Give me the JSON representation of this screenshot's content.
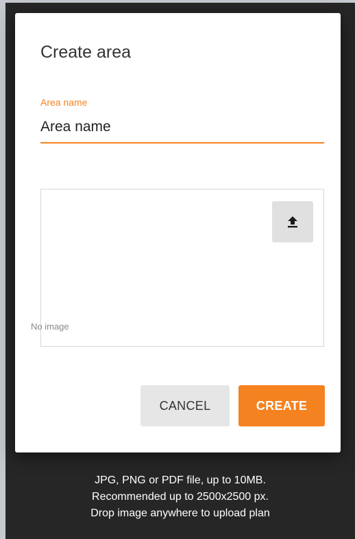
{
  "dialog": {
    "title": "Create area",
    "name_field": {
      "label": "Area name",
      "value": "Area name"
    },
    "image": {
      "empty_text": "No image",
      "upload_icon": "upload-icon"
    },
    "buttons": {
      "cancel": "CANCEL",
      "create": "CREATE"
    }
  },
  "hints": [
    "JPG, PNG or PDF file, up to 10MB.",
    "Recommended up to 2500x2500 px.",
    "Drop image anywhere to upload plan"
  ],
  "colors": {
    "accent": "#f58220",
    "overlay": "#262626",
    "backdrop": "#c5c8ce"
  }
}
